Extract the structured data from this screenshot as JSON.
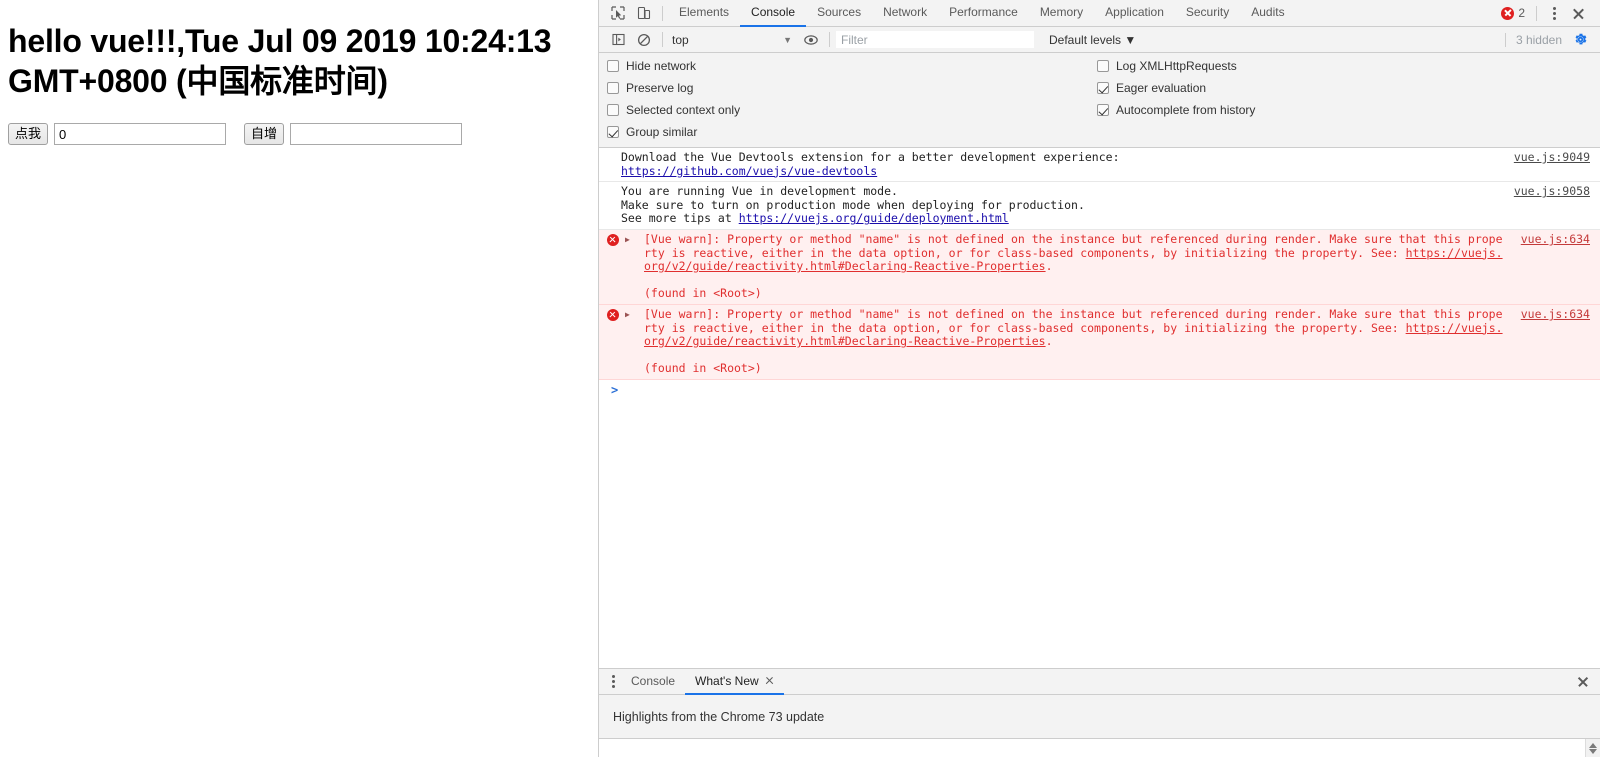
{
  "page": {
    "heading": "hello vue!!!,Tue Jul 09 2019 10:24:13 GMT+0800 (中国标准时间)",
    "click_button_label": "点我",
    "counter_value": "0",
    "increment_button_label": "自增",
    "text_input_value": ""
  },
  "devtools": {
    "tabs": [
      {
        "label": "Elements",
        "active": false
      },
      {
        "label": "Console",
        "active": true
      },
      {
        "label": "Sources",
        "active": false
      },
      {
        "label": "Network",
        "active": false
      },
      {
        "label": "Performance",
        "active": false
      },
      {
        "label": "Memory",
        "active": false
      },
      {
        "label": "Application",
        "active": false
      },
      {
        "label": "Security",
        "active": false
      },
      {
        "label": "Audits",
        "active": false
      }
    ],
    "error_count": "2",
    "console_toolbar": {
      "context": "top",
      "context_caret": "▼",
      "filter_placeholder": "Filter",
      "filter_value": "",
      "levels_label": "Default levels ▼",
      "hidden_label": "3 hidden"
    },
    "settings": {
      "left": [
        {
          "label": "Hide network",
          "checked": false
        },
        {
          "label": "Preserve log",
          "checked": false
        },
        {
          "label": "Selected context only",
          "checked": false
        },
        {
          "label": "Group similar",
          "checked": true
        }
      ],
      "right": [
        {
          "label": "Log XMLHttpRequests",
          "checked": false
        },
        {
          "label": "Eager evaluation",
          "checked": true
        },
        {
          "label": "Autocomplete from history",
          "checked": true
        }
      ]
    },
    "messages": [
      {
        "level": "info",
        "source": "vue.js:9049",
        "lines": [
          {
            "text": "Download the Vue Devtools extension for a better development experience:"
          },
          {
            "link": "https://github.com/vuejs/vue-devtools"
          }
        ]
      },
      {
        "level": "info",
        "source": "vue.js:9058",
        "lines": [
          {
            "text": "You are running Vue in development mode."
          },
          {
            "text": "Make sure to turn on production mode when deploying for production."
          },
          {
            "text": "See more tips at ",
            "link": "https://vuejs.org/guide/deployment.html"
          }
        ]
      },
      {
        "level": "error",
        "source": "vue.js:634",
        "lines": [
          {
            "text": "[Vue warn]: Property or method \"name\" is not defined on the instance but referenced during render. Make sure that this property"
          },
          {
            "text": "is reactive, either in the data option, or for class-based components, by initializing the property. See: ",
            "link": "https://vuejs.org/v2/guide/reactivity.html#Declaring-Reactive-Properties",
            "suffix": "."
          },
          {
            "text": ""
          },
          {
            "text": "(found in <Root>)"
          }
        ]
      },
      {
        "level": "error",
        "source": "vue.js:634",
        "lines": [
          {
            "text": "[Vue warn]: Property or method \"name\" is not defined on the instance but referenced during render. Make sure that this property"
          },
          {
            "text": "is reactive, either in the data option, or for class-based components, by initializing the property. See: ",
            "link": "https://vuejs.org/v2/guide/reactivity.html#Declaring-Reactive-Properties",
            "suffix": "."
          },
          {
            "text": ""
          },
          {
            "text": "(found in <Root>)"
          }
        ]
      }
    ],
    "prompt": ">",
    "drawer": {
      "tabs": [
        {
          "label": "Console",
          "active": false,
          "closable": false
        },
        {
          "label": "What's New",
          "active": true,
          "closable": true
        }
      ],
      "content": "Highlights from the Chrome 73 update"
    }
  }
}
